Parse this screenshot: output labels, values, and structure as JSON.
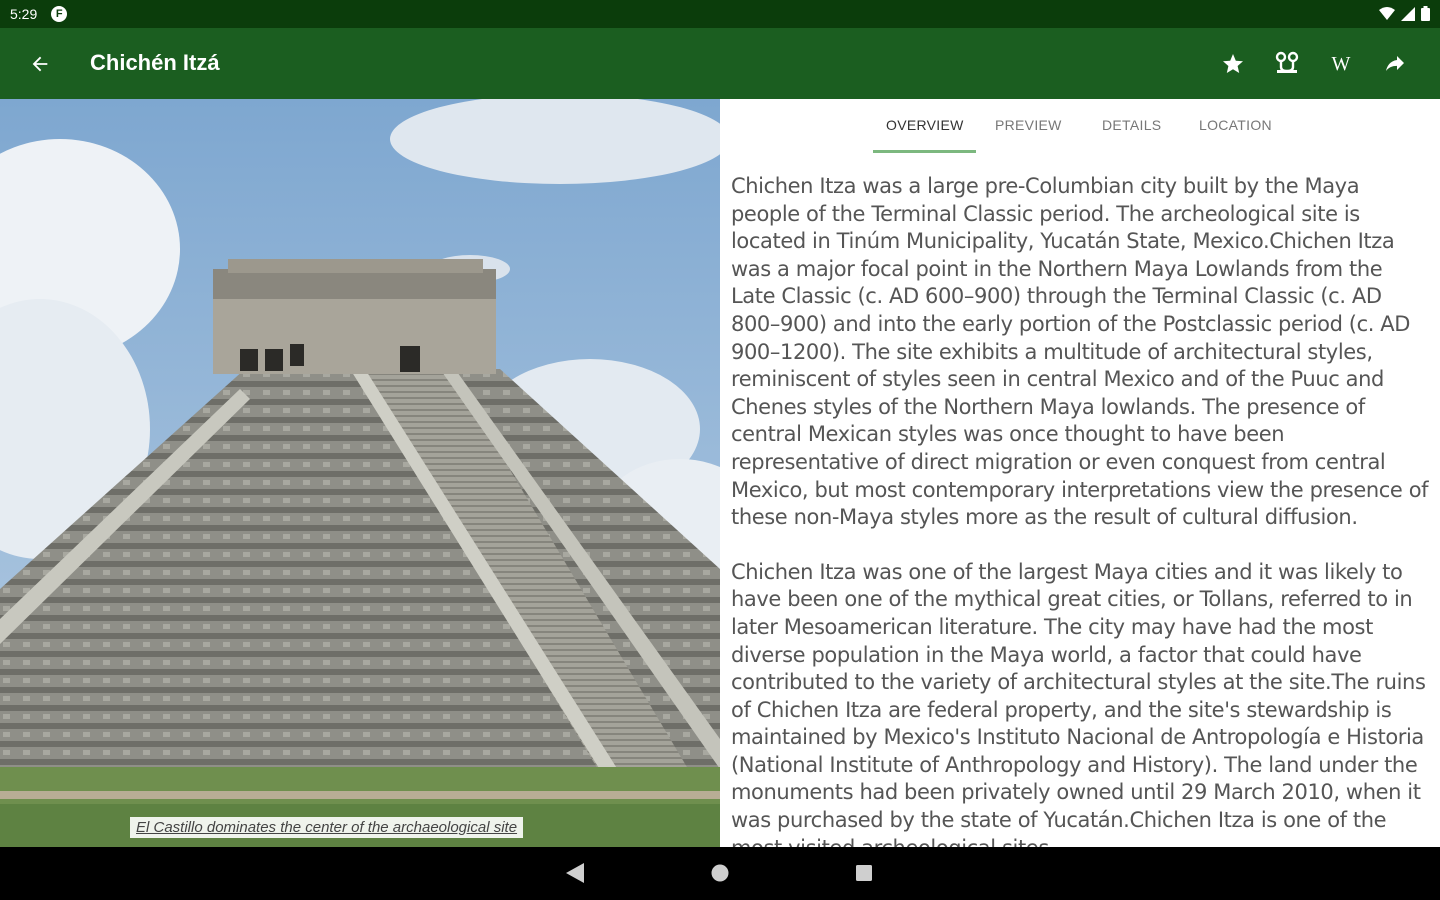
{
  "status": {
    "time": "5:29",
    "notification_icon": "F"
  },
  "appbar": {
    "title": "Chichén Itzá",
    "actions": [
      "star-icon",
      "route-icon",
      "wikipedia-icon",
      "share-icon"
    ],
    "wiki_label": "W"
  },
  "colors": {
    "status_bg": "#0b3d0b",
    "appbar_bg": "#1b5e20",
    "tab_indicator": "#7cb87f"
  },
  "image": {
    "caption": "El Castillo dominates the center of the archaeological site"
  },
  "tabs": [
    {
      "label": "OVERVIEW",
      "active": true
    },
    {
      "label": "PREVIEW",
      "active": false
    },
    {
      "label": "DETAILS",
      "active": false
    },
    {
      "label": "LOCATION",
      "active": false
    }
  ],
  "article": {
    "p1": "Chichen Itza was a large pre-Columbian city built by the Maya people of the Terminal Classic period. The archeological site is located in Tinúm Municipality, Yucatán State, Mexico.Chichen Itza was a major focal point in the Northern Maya Lowlands from the Late Classic (c. AD 600–900) through the Terminal Classic (c. AD 800–900) and into the early portion of the Postclassic period (c. AD 900–1200). The site exhibits a multitude of architectural styles, reminiscent of styles seen in central Mexico and of the Puuc and Chenes styles of the Northern Maya lowlands. The presence of central Mexican styles was once thought to have been representative of direct migration or even conquest from central Mexico, but most contemporary interpretations view the presence of these non-Maya styles more as the result of cultural diffusion.",
    "p2": "Chichen Itza was one of the largest Maya cities and it was likely to have been one of the mythical great cities, or Tollans, referred to in later Mesoamerican literature. The city may have had the most diverse population in the Maya world, a factor that could have contributed to the variety of architectural styles at the site.The ruins of Chichen Itza are federal property, and the site's stewardship is maintained by Mexico's Instituto Nacional de Antropología e Historia (National Institute of Anthropology and History). The land under the monuments had been privately owned until 29 March 2010, when it was purchased by the state of Yucatán.Chichen Itza is one of the most visited archeological sites"
  }
}
